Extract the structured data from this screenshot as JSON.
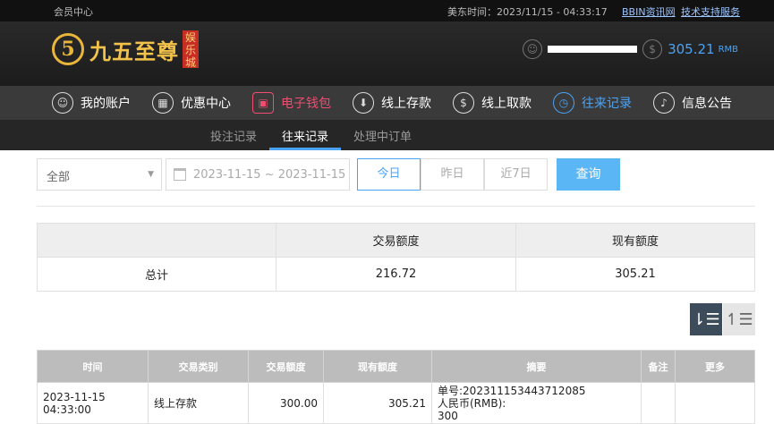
{
  "topbar": {
    "member_center": "会员中心",
    "time_label": "美东时间：2023/11/15 - 04:33:17",
    "links": [
      "BBIN资讯网",
      "技术支持服务"
    ]
  },
  "header": {
    "logo_mark": "5",
    "logo_text": "九五至尊",
    "logo_tag": "娱乐城",
    "balance": "305.21",
    "currency": "RMB"
  },
  "nav": {
    "items": [
      {
        "label": "我的账户",
        "icon": "user-icon",
        "glyph": "☺"
      },
      {
        "label": "优惠中心",
        "icon": "gift-icon",
        "glyph": "▦"
      },
      {
        "label": "电子钱包",
        "icon": "wallet-icon",
        "glyph": "▣"
      },
      {
        "label": "线上存款",
        "icon": "deposit-icon",
        "glyph": "⬇"
      },
      {
        "label": "线上取款",
        "icon": "withdraw-icon",
        "glyph": "$"
      },
      {
        "label": "往来记录",
        "icon": "record-icon",
        "glyph": "◷"
      },
      {
        "label": "信息公告",
        "icon": "bell-icon",
        "glyph": "♪"
      }
    ]
  },
  "subnav": {
    "tabs": [
      "投注记录",
      "往来记录",
      "处理中订单"
    ]
  },
  "filters": {
    "type_value": "全部",
    "date_range": "2023-11-15 ~ 2023-11-15",
    "quick": [
      "今日",
      "昨日",
      "近7日"
    ],
    "query_label": "查询"
  },
  "summary": {
    "headers": [
      "",
      "交易额度",
      "现有额度"
    ],
    "row": [
      "总计",
      "216.72",
      "305.21"
    ]
  },
  "records": {
    "headers": [
      "时间",
      "交易类别",
      "交易额度",
      "现有额度",
      "摘要",
      "备注",
      "更多"
    ],
    "rows": [
      {
        "time": "2023-11-15 04:33:00",
        "type": "线上存款",
        "amount": "300.00",
        "balance": "305.21",
        "summary_line1": "单号:202311153443712085",
        "summary_line2": "人民币(RMB):",
        "summary_line3": "300",
        "note": "",
        "more": ""
      }
    ]
  }
}
